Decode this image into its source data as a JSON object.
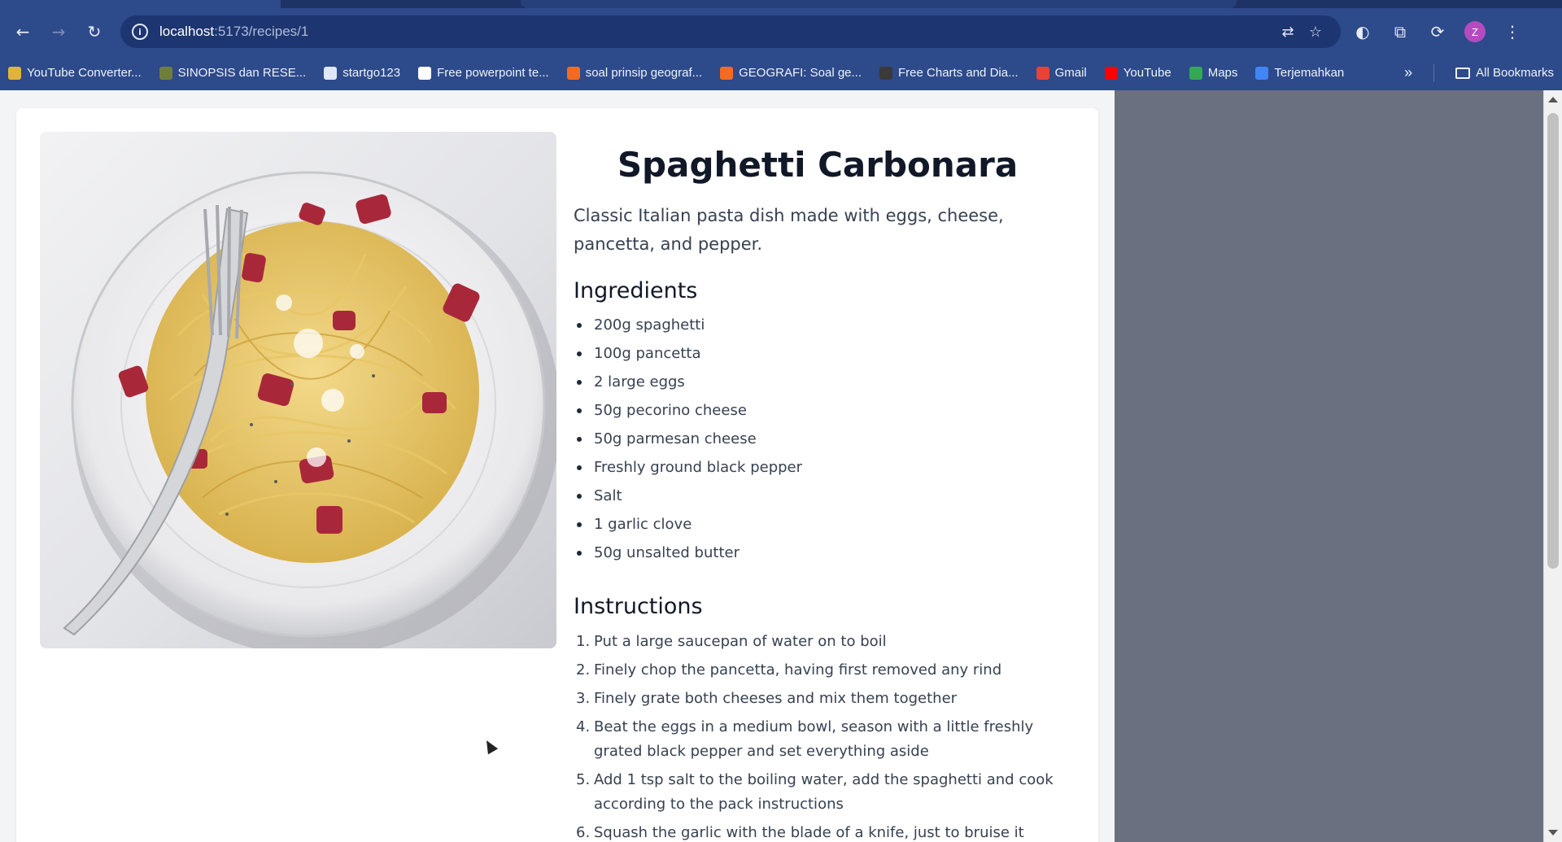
{
  "browser": {
    "url_host": "localhost",
    "url_path": ":5173/recipes/1",
    "avatar_letter": "Z",
    "bookmarks": [
      {
        "label": "YouTube Converter...",
        "color": "#e0b43a"
      },
      {
        "label": "SINOPSIS dan RESE...",
        "color": "#6f7f3a"
      },
      {
        "label": "startgo123",
        "color": "#dfe6f5"
      },
      {
        "label": "Free powerpoint te...",
        "color": "#ffffff"
      },
      {
        "label": "soal prinsip geograf...",
        "color": "#f26b21"
      },
      {
        "label": "GEOGRAFI: Soal ge...",
        "color": "#f26b21"
      },
      {
        "label": "Free Charts and Dia...",
        "color": "#3a3a3a"
      },
      {
        "label": "Gmail",
        "color": "#ea4335"
      },
      {
        "label": "YouTube",
        "color": "#ff0000"
      },
      {
        "label": "Maps",
        "color": "#34a853"
      },
      {
        "label": "Terjemahkan",
        "color": "#4285f4"
      }
    ],
    "more_bookmarks": "»",
    "all_bookmarks": "All Bookmarks"
  },
  "recipe": {
    "title": "Spaghetti Carbonara",
    "description": "Classic Italian pasta dish made with eggs, cheese, pancetta, and pepper.",
    "ingredients_heading": "Ingredients",
    "ingredients": [
      "200g spaghetti",
      "100g pancetta",
      "2 large eggs",
      "50g pecorino cheese",
      "50g parmesan cheese",
      "Freshly ground black pepper",
      "Salt",
      "1 garlic clove",
      "50g unsalted butter"
    ],
    "instructions_heading": "Instructions",
    "instructions": [
      {
        "num": "1.",
        "text": "Put a large saucepan of water on to boil"
      },
      {
        "num": "2.",
        "text": "Finely chop the pancetta, having first removed any rind"
      },
      {
        "num": "3.",
        "text": "Finely grate both cheeses and mix them together"
      },
      {
        "num": "4.",
        "text": "Beat the eggs in a medium bowl, season with a little freshly grated black pepper and set everything aside"
      },
      {
        "num": "5.",
        "text": "Add 1 tsp salt to the boiling water, add the spaghetti and cook according to the pack instructions"
      },
      {
        "num": "6.",
        "text": "Squash the garlic with the blade of a knife, just to bruise it"
      }
    ]
  }
}
